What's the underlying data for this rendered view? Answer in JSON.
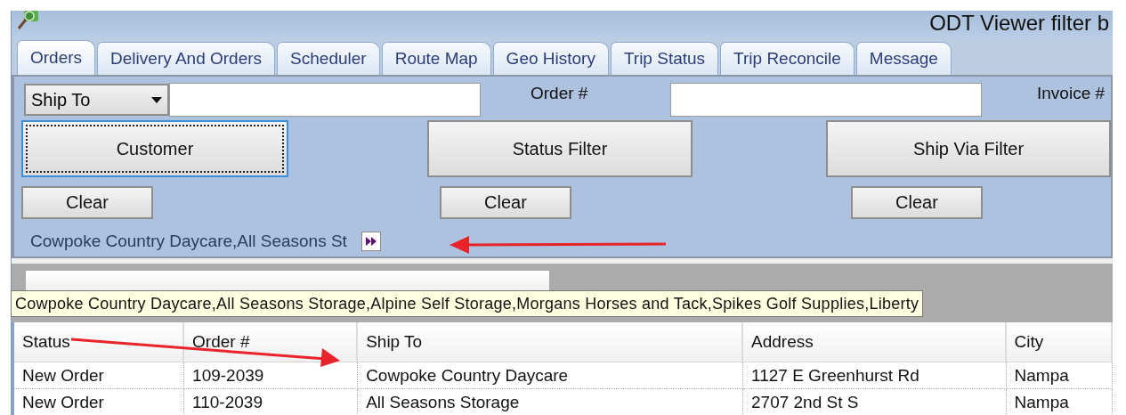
{
  "window": {
    "title": "ODT Viewer filter b"
  },
  "tabs": [
    {
      "label": "Orders",
      "selected": true
    },
    {
      "label": "Delivery And Orders",
      "selected": false
    },
    {
      "label": "Scheduler",
      "selected": false
    },
    {
      "label": "Route Map",
      "selected": false
    },
    {
      "label": "Geo History",
      "selected": false
    },
    {
      "label": "Trip Status",
      "selected": false
    },
    {
      "label": "Trip Reconcile",
      "selected": false
    },
    {
      "label": "Message",
      "selected": false
    }
  ],
  "filters": {
    "field_selector": "Ship To",
    "order_label": "Order #",
    "invoice_label": "Invoice #"
  },
  "filter_buttons": [
    {
      "label": "Customer",
      "focused": true
    },
    {
      "label": "Status Filter",
      "focused": false
    },
    {
      "label": "Ship Via Filter",
      "focused": false
    }
  ],
  "clear_buttons": [
    "Clear",
    "Clear",
    "Clear"
  ],
  "selection_summary": "Cowpoke Country Daycare,All Seasons St",
  "tooltip": "Cowpoke Country Daycare,All Seasons Storage,Alpine Self Storage,Morgans Horses and Tack,Spikes Golf Supplies,Liberty",
  "table": {
    "columns": [
      "Status",
      "Order #",
      "Ship To",
      "Address",
      "City"
    ],
    "rows": [
      [
        "New Order",
        "109-2039",
        "Cowpoke Country Daycare",
        "1127 E Greenhurst Rd",
        "Nampa"
      ],
      [
        "New Order",
        "110-2039",
        "All Seasons Storage",
        "2707 2nd St S",
        "Nampa"
      ]
    ]
  }
}
